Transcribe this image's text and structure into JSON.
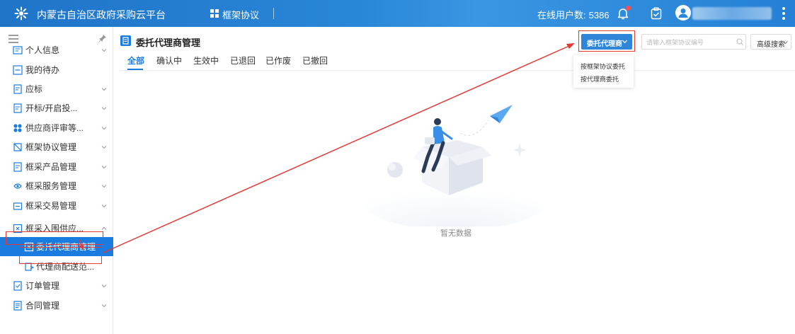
{
  "header": {
    "app_title": "内蒙古自治区政府采购云平台",
    "module_label": "框架协议",
    "online_label": "在线用户数:",
    "online_count": "5386",
    "icons": [
      "logo-icon",
      "grid-icon",
      "bell-icon",
      "clipboard-check-icon",
      "avatar-icon",
      "more-vertical-icon"
    ]
  },
  "sidebar": {
    "items": [
      {
        "label": "个人信息",
        "icon": "id-card-icon",
        "expandable": true
      },
      {
        "label": "我的待办",
        "icon": "todo-icon",
        "expandable": false
      },
      {
        "label": "应标",
        "icon": "document-icon",
        "expandable": true
      },
      {
        "label": "开标/开启投...",
        "icon": "document-icon",
        "expandable": true
      },
      {
        "label": "供应商评审等...",
        "icon": "apps-icon",
        "expandable": true
      },
      {
        "label": "框架协议管理",
        "icon": "frame-icon",
        "expandable": true
      },
      {
        "label": "框采产品管理",
        "icon": "document-icon",
        "expandable": true
      },
      {
        "label": "框采服务管理",
        "icon": "service-icon",
        "expandable": true
      },
      {
        "label": "框采交易管理",
        "icon": "transaction-icon",
        "expandable": true
      },
      {
        "label": "框采入围供应...",
        "icon": "supplier-icon",
        "expandable": true,
        "expanded": true
      },
      {
        "label": "委托代理商管理",
        "icon": "supplier-icon",
        "sub": true,
        "active": true
      },
      {
        "label": "代理商配送范...",
        "icon": "delivery-icon",
        "sub": true
      },
      {
        "label": "订单管理",
        "icon": "order-icon",
        "expandable": true
      },
      {
        "label": "合同管理",
        "icon": "contract-icon",
        "expandable": true
      }
    ]
  },
  "main": {
    "page_title": "委托代理商管理",
    "tabs": [
      "全部",
      "确认中",
      "生效中",
      "已退回",
      "已作废",
      "已撤回"
    ],
    "active_tab": 0,
    "agent_button": "委托代理商",
    "search_placeholder": "请输入框架协议编号",
    "search_value": "",
    "advanced_search": "高级搜索",
    "dropdown_items": [
      "按框架协议委托",
      "按代理商委托"
    ],
    "empty_text": "暂无数据"
  },
  "colors": {
    "header_blue": "#2a86d8",
    "accent": "#1a7cde",
    "annotation_red": "#e53935"
  }
}
